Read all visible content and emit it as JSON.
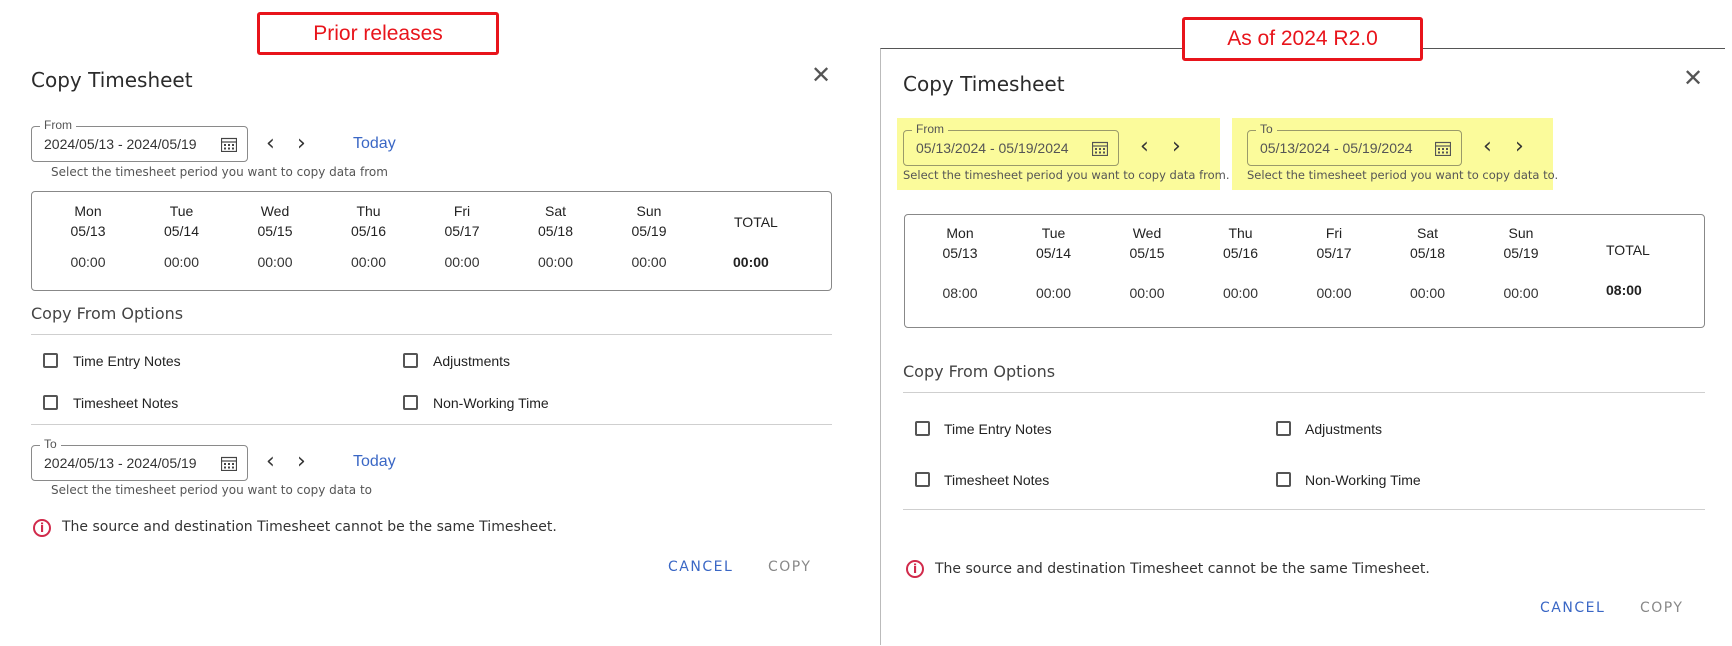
{
  "left": {
    "callout": "Prior releases",
    "title": "Copy Timesheet",
    "from": {
      "label": "From",
      "value": "2024/05/13 - 2024/05/19",
      "helper": "Select the timesheet period you want to copy data from",
      "today": "Today"
    },
    "days": [
      {
        "name": "Mon",
        "date": "05/13",
        "hours": "00:00"
      },
      {
        "name": "Tue",
        "date": "05/14",
        "hours": "00:00"
      },
      {
        "name": "Wed",
        "date": "05/15",
        "hours": "00:00"
      },
      {
        "name": "Thu",
        "date": "05/16",
        "hours": "00:00"
      },
      {
        "name": "Fri",
        "date": "05/17",
        "hours": "00:00"
      },
      {
        "name": "Sat",
        "date": "05/18",
        "hours": "00:00"
      },
      {
        "name": "Sun",
        "date": "05/19",
        "hours": "00:00"
      }
    ],
    "total_label": "TOTAL",
    "total_value": "00:00",
    "options_heading": "Copy From Options",
    "options": [
      "Time Entry Notes",
      "Adjustments",
      "Timesheet Notes",
      "Non-Working Time"
    ],
    "to": {
      "label": "To",
      "value": "2024/05/13 - 2024/05/19",
      "helper": "Select the timesheet period you want to copy data to",
      "today": "Today"
    },
    "error": "The source and destination Timesheet cannot be the same Timesheet.",
    "cancel": "CANCEL",
    "copy": "COPY"
  },
  "right": {
    "callout": "As of 2024 R2.0",
    "title": "Copy Timesheet",
    "from": {
      "label": "From",
      "value": "05/13/2024 - 05/19/2024",
      "helper": "Select the timesheet period you want to copy data from."
    },
    "to": {
      "label": "To",
      "value": "05/13/2024 - 05/19/2024",
      "helper": "Select the timesheet period you want to copy data to."
    },
    "days": [
      {
        "name": "Mon",
        "date": "05/13",
        "hours": "08:00"
      },
      {
        "name": "Tue",
        "date": "05/14",
        "hours": "00:00"
      },
      {
        "name": "Wed",
        "date": "05/15",
        "hours": "00:00"
      },
      {
        "name": "Thu",
        "date": "05/16",
        "hours": "00:00"
      },
      {
        "name": "Fri",
        "date": "05/17",
        "hours": "00:00"
      },
      {
        "name": "Sat",
        "date": "05/18",
        "hours": "00:00"
      },
      {
        "name": "Sun",
        "date": "05/19",
        "hours": "00:00"
      }
    ],
    "total_label": "TOTAL",
    "total_value": "08:00",
    "options_heading": "Copy From Options",
    "options": [
      "Time Entry Notes",
      "Adjustments",
      "Timesheet Notes",
      "Non-Working Time"
    ],
    "error": "The source and destination Timesheet cannot be the same Timesheet.",
    "cancel": "CANCEL",
    "copy": "COPY"
  },
  "colors": {
    "callout": "#e8141b",
    "highlight": "#fbfb9b",
    "link": "#3a67c5",
    "error": "#d12a4b"
  }
}
